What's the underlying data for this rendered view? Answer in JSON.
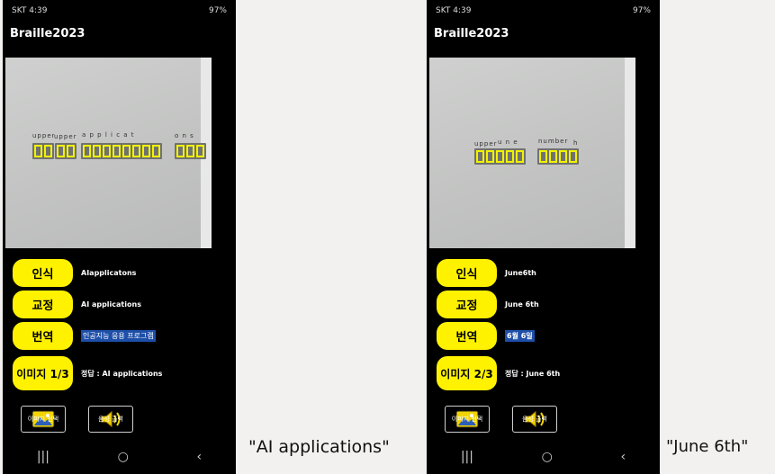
{
  "screens": [
    {
      "status_time": "SKT 4:39",
      "status_right": "97%",
      "app_title": "Braille2023",
      "detections": {
        "labels": [
          "upper",
          "upper",
          "a p p l i c a t",
          "o n s"
        ]
      },
      "recognize_label": "인식",
      "recognize_value": "AIapplicatons",
      "correct_label": "교정",
      "correct_value": "AI applications",
      "translate_label": "번역",
      "translate_value": "인공지능 응용 프로그램",
      "image_label": "이미지 1/3",
      "answer_value": "정답 : AI applications",
      "image_select_label": "이미지 선택",
      "audio_label": "음성 출력",
      "nav": [
        "|||",
        "○",
        "‹"
      ]
    },
    {
      "status_time": "SKT 4:39",
      "status_right": "97%",
      "app_title": "Braille2023",
      "detections": {
        "labels": [
          "upper",
          "u n e",
          "number",
          "h"
        ]
      },
      "recognize_label": "인식",
      "recognize_value": "June6th",
      "correct_label": "교정",
      "correct_value": "June 6th",
      "translate_label": "번역",
      "translate_value": "6월 6일",
      "image_label": "이미지 2/3",
      "answer_value": "정답 : June 6th",
      "image_select_label": "이미지 선택",
      "audio_label": "음성 출력",
      "nav": [
        "|||",
        "○",
        "‹"
      ]
    }
  ],
  "captions": [
    "\"AI applications\"",
    "\"June 6th\""
  ],
  "colors": {
    "accent": "#fff200",
    "highlight": "#1e4fa8",
    "background": "#f2f1ef"
  }
}
